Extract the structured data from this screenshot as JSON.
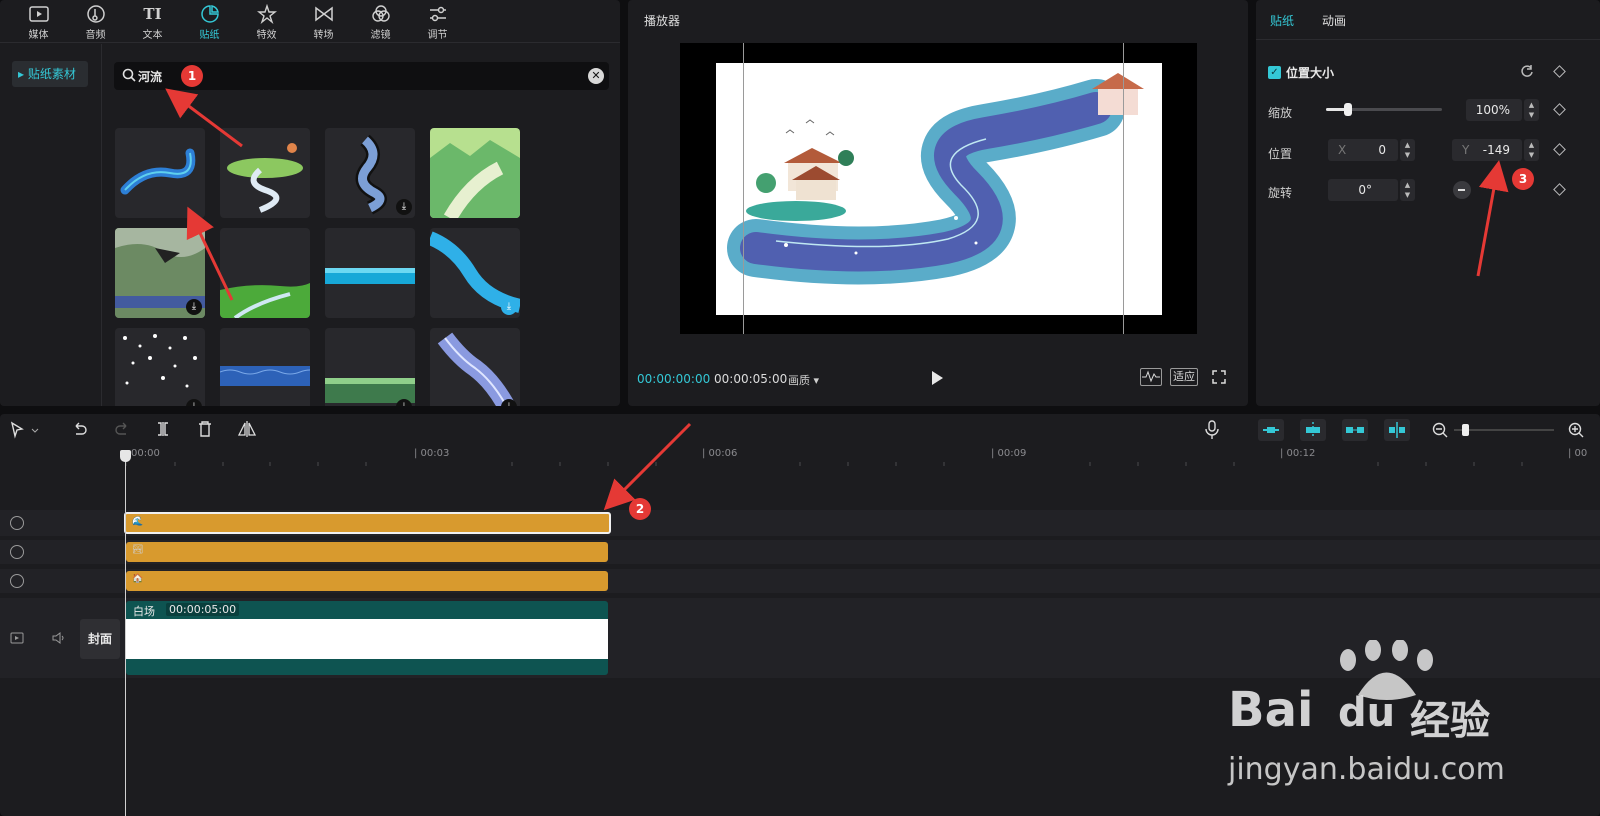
{
  "toolbar_tabs": [
    {
      "label": "媒体",
      "icon": "media-icon"
    },
    {
      "label": "音频",
      "icon": "audio-icon"
    },
    {
      "label": "文本",
      "icon": "text-icon",
      "glyph": "TI"
    },
    {
      "label": "贴纸",
      "icon": "sticker-icon",
      "active": true
    },
    {
      "label": "特效",
      "icon": "effects-icon"
    },
    {
      "label": "转场",
      "icon": "transition-icon"
    },
    {
      "label": "滤镜",
      "icon": "filter-icon"
    },
    {
      "label": "调节",
      "icon": "adjust-icon"
    }
  ],
  "sidebar": {
    "item": "▸ 贴纸素材"
  },
  "search": {
    "query": "河流",
    "clear": "✕"
  },
  "player": {
    "title": "播放器",
    "current_time": "00:00:00:00",
    "total_time": "00:00:05:00",
    "quality": "画质 ▾",
    "fit_label": "适应"
  },
  "properties": {
    "tabs": [
      "贴纸",
      "动画"
    ],
    "section": "位置大小",
    "scale_label": "缩放",
    "scale_value": "100%",
    "scale_fraction": 0.19,
    "position_label": "位置",
    "x_prefix": "X",
    "x_value": "0",
    "y_prefix": "Y",
    "y_value": "-149",
    "rotation_label": "旋转",
    "rotation_value": "0°"
  },
  "timeline": {
    "ticks": [
      "00:00",
      "| 00:03",
      "| 00:06",
      "| 00:09",
      "| 00:12",
      "| 00"
    ],
    "main_clip_name": "白场",
    "main_clip_duration": "00:00:05:00",
    "cover_label": "封面"
  },
  "annotations": [
    "1",
    "2",
    "3"
  ],
  "watermark": {
    "brand": "Bai",
    "brand2": "du",
    "suffix": "经验",
    "url": "jingyan.baidu.com"
  },
  "colors": {
    "accent": "#34c8d6",
    "clip": "#d89a2e",
    "main_track": "#0e5451",
    "annotation": "#e53935"
  }
}
